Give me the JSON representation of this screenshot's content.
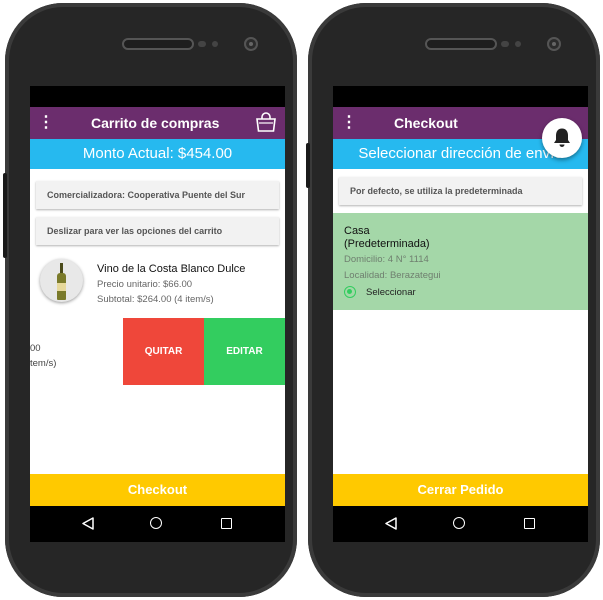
{
  "left_screen": {
    "header": {
      "title": "Carrito de compras",
      "menu_icon": "more-vert-icon",
      "cart_icon": "shopping-bag-icon"
    },
    "amount_bar": {
      "text": "Monto Actual: $454.00"
    },
    "seller_card": {
      "text": "Comercializadora: Cooperativa Puente del Sur"
    },
    "hint_card": {
      "text": "Deslizar para ver las opciones del carrito"
    },
    "product": {
      "name": "Vino de la Costa Blanco Dulce",
      "unit_price": "Precio unitario: $66.00",
      "subtotal": "Subtotal: $264.00 (4 item/s)"
    },
    "swiped_row": {
      "fragment_1": "00",
      "fragment_2": "tem/s)"
    },
    "swipe_actions": {
      "remove": "QUITAR",
      "edit": "EDITAR"
    },
    "bottom_button": {
      "label": "Checkout"
    }
  },
  "right_screen": {
    "header": {
      "title": "Checkout",
      "menu_icon": "more-vert-icon"
    },
    "subtitle_bar": {
      "text": "Seleccionar dirección de envío"
    },
    "info_card": {
      "text": "Por defecto, se utiliza la predeterminada"
    },
    "address": {
      "name": "Casa",
      "default_tag": "(Predeterminada)",
      "domicilio": "Domicilio: 4 N° 1114",
      "localidad": "Localidad: Berazategui",
      "select_label": "Seleccionar",
      "selected": true
    },
    "fab_icon": "notification-bell-icon",
    "bottom_button": {
      "label": "Cerrar Pedido"
    }
  },
  "navigation": {
    "back_icon": "back-triangle-icon",
    "home_icon": "home-circle-icon",
    "recents_icon": "recents-square-icon"
  },
  "colors": {
    "appbar": "#6b2d6d",
    "subbar": "#26b9ef",
    "action_button": "#ffc900",
    "remove": "#ef473a",
    "edit": "#33cd5f",
    "address_bg": "#a4d7a8"
  }
}
